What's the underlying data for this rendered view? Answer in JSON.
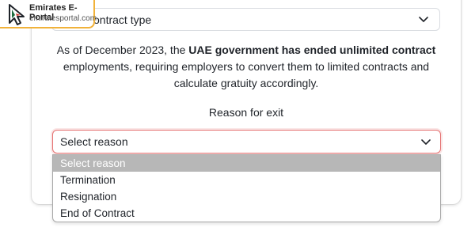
{
  "logo": {
    "title": "Emirates E-Portal",
    "url": "emiratesportal.com",
    "colors": {
      "accent": "#f1b23a",
      "mark": "#1c6b3d"
    }
  },
  "contract_select": {
    "label": "ontract type",
    "icon": "chevron-down-icon"
  },
  "notice": {
    "part1": "As of December 2023, the ",
    "bold": "UAE government has ended unlimited contract",
    "part2": " employments, requiring employers to convert them to limited contracts and calculate gratuity accordingly."
  },
  "reason": {
    "label": "Reason for exit",
    "selected_value": "Select reason",
    "border_color": "#e57373",
    "icon": "chevron-down-icon",
    "options": [
      {
        "label": "Select reason",
        "selected": true
      },
      {
        "label": "Termination",
        "selected": false
      },
      {
        "label": "Resignation",
        "selected": false
      },
      {
        "label": "End of Contract",
        "selected": false
      }
    ]
  }
}
